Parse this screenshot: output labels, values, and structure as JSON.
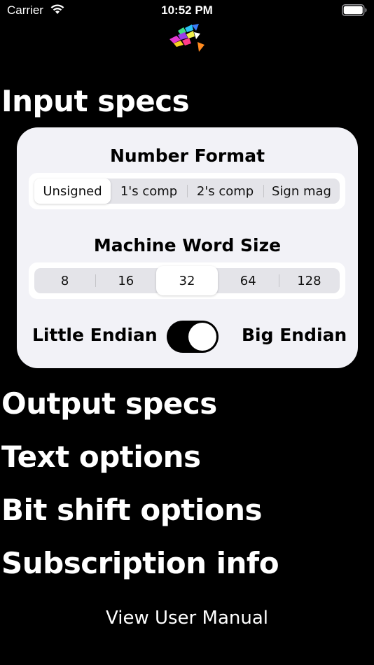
{
  "status_bar": {
    "carrier": "Carrier",
    "time": "10:52 PM"
  },
  "sections": {
    "input_specs": "Input specs",
    "output_specs": "Output specs",
    "text_options": "Text options",
    "bit_shift_options": "Bit shift options",
    "subscription_info": "Subscription info"
  },
  "input_card": {
    "number_format_label": "Number Format",
    "number_format_options": [
      "Unsigned",
      "1's comp",
      "2's comp",
      "Sign mag"
    ],
    "number_format_selected": "Unsigned",
    "word_size_label": "Machine Word Size",
    "word_size_options": [
      "8",
      "16",
      "32",
      "64",
      "128"
    ],
    "word_size_selected": "32",
    "endian_left_label": "Little Endian",
    "endian_right_label": "Big Endian",
    "endian_toggle_on": true
  },
  "footer": {
    "manual_link": "View User Manual"
  },
  "colors": {
    "background": "#000000",
    "card": "#f2f2f7",
    "segment_track": "#e4e4e9"
  }
}
